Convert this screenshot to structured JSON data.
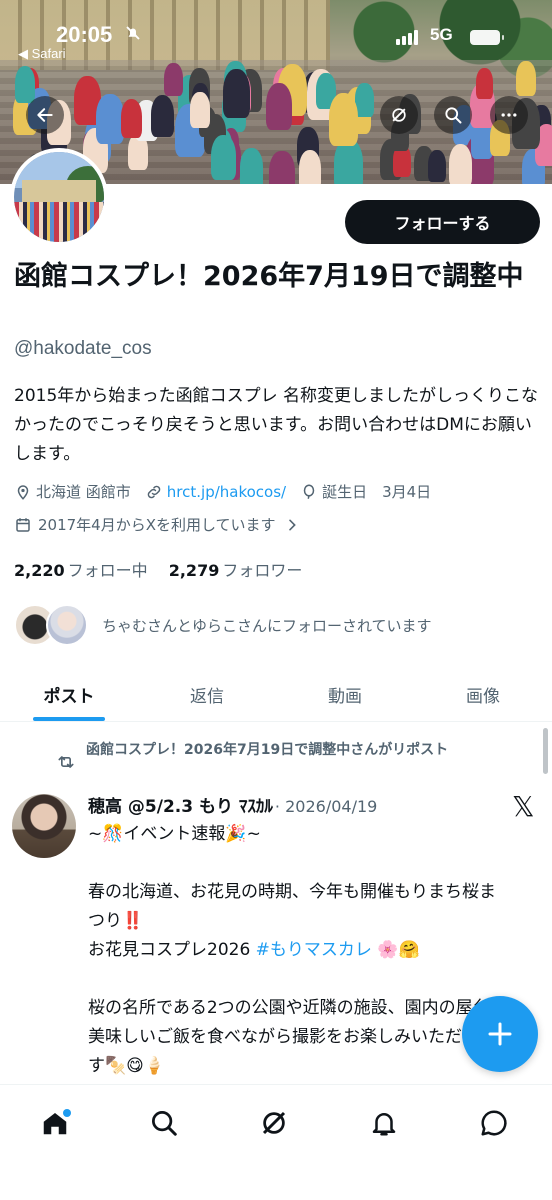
{
  "status_bar": {
    "time": "20:05",
    "back_app": "◀ Safari",
    "network": "5G"
  },
  "header": {
    "follow_label": "フォローする"
  },
  "profile": {
    "name": "函館コスプレ！2026年7月19日で調整中",
    "handle": "@hakodate_cos",
    "bio": "2015年から始まった函館コスプレ 名称変更しましたがしっくりこなかったのでこっそり戻そうと思います。お問い合わせはDMにお願いします。",
    "location": "北海道 函館市",
    "link": "hrct.jp/hakocos/",
    "birthday": "誕生日　3月4日",
    "joined": "2017年4月からXを利用しています",
    "following_count": "2,220",
    "following_label": "フォロー中",
    "followers_count": "2,279",
    "followers_label": "フォロワー",
    "followed_by": "ちゃむさんとゆらこさんにフォローされています"
  },
  "tabs": [
    {
      "label": "ポスト",
      "active": true
    },
    {
      "label": "返信",
      "active": false
    },
    {
      "label": "動画",
      "active": false
    },
    {
      "label": "画像",
      "active": false
    }
  ],
  "post": {
    "repost_text": "函館コスプレ！2026年7月19日で調整中さんがリポスト",
    "author": "穂高 @5/2.3 もり ﾏｽｶﾙ",
    "date": "· 2026/04/19",
    "line1": "~🎊イベント速報🎉~",
    "line2": "春の北海道、お花見の時期、今年も開催もりまち桜まつり",
    "line2_mark": "‼️",
    "line3a": "お花見コスプレ2026 ",
    "hashtag": "#もりマスカレ",
    "line3b": " 🌸🤗",
    "line4": "桜の名所である2つの公園や近隣の施設、園内の屋台で美味しいご飯を食べながら撮影をお楽しみいただけます🍢😋🍦"
  },
  "colors": {
    "accent": "#1d9bf0",
    "text": "#0f1419",
    "secondary": "#536471"
  }
}
